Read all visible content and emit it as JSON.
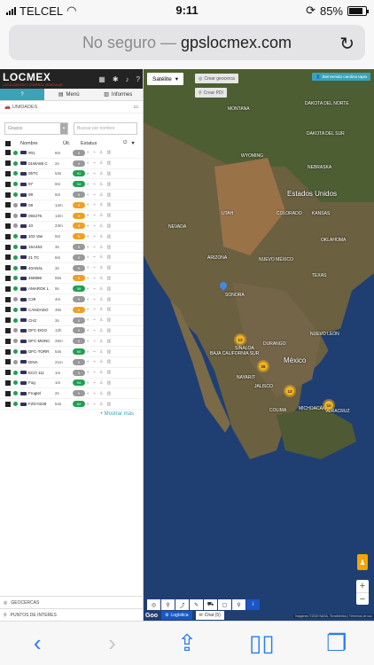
{
  "status": {
    "carrier": "TELCEL",
    "time": "9:11",
    "battery": "85%"
  },
  "browser": {
    "insecure_label": "No seguro",
    "separator": "—",
    "domain": "gpslocmex.com"
  },
  "app": {
    "logo": "LOCMEX",
    "logo_sub": "LOCALIZACIÓN Y CONTROL VEHICULAR",
    "tabs": [
      {
        "label": "?"
      },
      {
        "label": "Menú"
      },
      {
        "label": "Informes"
      }
    ],
    "unidades_label": "UNIDADES",
    "filter": {
      "select_placeholder": "Grupos",
      "search_placeholder": "Buscar por nombre"
    },
    "columns": {
      "name": "Nombre",
      "last": "Últ.",
      "status": "Estatus"
    },
    "rows": [
      {
        "name": "#01",
        "time": "6m",
        "dot": "#20a050",
        "badge": "0",
        "badge_color": "#999"
      },
      {
        "name": "01WA85 C",
        "time": "2s",
        "dot": "#20a050",
        "badge": "0",
        "badge_color": "#999"
      },
      {
        "name": "05TC",
        "time": "53s",
        "dot": "#20a050",
        "badge": "91",
        "badge_color": "#20a050"
      },
      {
        "name": "07",
        "time": "6m",
        "dot": "#20a050",
        "badge": "34",
        "badge_color": "#20a050"
      },
      {
        "name": "08",
        "time": "6m",
        "dot": "#20a050",
        "badge": "0",
        "badge_color": "#999"
      },
      {
        "name": "09",
        "time": "12m",
        "dot": "#999",
        "badge": "0",
        "badge_color": "#f0a020"
      },
      {
        "name": "094276",
        "time": "13m",
        "dot": "#999",
        "badge": "0",
        "badge_color": "#f0a020"
      },
      {
        "name": "10",
        "time": "23m",
        "dot": "#999",
        "badge": "0",
        "badge_color": "#f0a020"
      },
      {
        "name": "102 Van",
        "time": "5m",
        "dot": "#20a050",
        "badge": "0",
        "badge_color": "#f0a020"
      },
      {
        "name": "15A453",
        "time": "3s",
        "dot": "#20a050",
        "badge": "0",
        "badge_color": "#999"
      },
      {
        "name": "21 TC",
        "time": "6m",
        "dot": "#20a050",
        "badge": "0",
        "badge_color": "#999"
      },
      {
        "name": "40AN4L",
        "time": "3s",
        "dot": "#20a050",
        "badge": "0",
        "badge_color": "#999"
      },
      {
        "name": "456996",
        "time": "55s",
        "dot": "#20a050",
        "badge": "0",
        "badge_color": "#f0a020"
      },
      {
        "name": "AMAROK L",
        "time": "9s",
        "dot": "#20a050",
        "badge": "39",
        "badge_color": "#20a050"
      },
      {
        "name": "C29",
        "time": "4m",
        "dot": "#999",
        "badge": "0",
        "badge_color": "#999"
      },
      {
        "name": "CANDADO",
        "time": "48s",
        "dot": "#20a050",
        "badge": "0",
        "badge_color": "#f0a020"
      },
      {
        "name": "CH2",
        "time": "3s",
        "dot": "#20a050",
        "badge": "0",
        "badge_color": "#999"
      },
      {
        "name": "DFC-DGO",
        "time": "12h",
        "dot": "#999",
        "badge": "0",
        "badge_color": "#999"
      },
      {
        "name": "DFC-MONC",
        "time": "26m",
        "dot": "#999",
        "badge": "0",
        "badge_color": "#999"
      },
      {
        "name": "DFC-TORR",
        "time": "54s",
        "dot": "#20a050",
        "badge": "50",
        "badge_color": "#20a050"
      },
      {
        "name": "DINA",
        "time": "21m",
        "dot": "#999",
        "badge": "0",
        "badge_color": "#999"
      },
      {
        "name": "ECO 111",
        "time": "1m",
        "dot": "#20a050",
        "badge": "0",
        "badge_color": "#999"
      },
      {
        "name": "Fog",
        "time": "1m",
        "dot": "#20a050",
        "badge": "94",
        "badge_color": "#20a050"
      },
      {
        "name": "Frogtel",
        "time": "2s",
        "dot": "#20a050",
        "badge": "0",
        "badge_color": "#999"
      },
      {
        "name": "FZD-0228",
        "time": "54s",
        "dot": "#20a050",
        "badge": "64",
        "badge_color": "#20a050"
      }
    ],
    "show_more": "+ Mostrar más",
    "bottom_links": [
      "GEOCERCAS",
      "PUNTOS DE INTERES"
    ]
  },
  "map": {
    "maptype": "Satélite",
    "crear_geocerca": "Crear geocerca",
    "crear_pdi": "Crear PDI",
    "welcome": "Bienvenido carolina tapia",
    "labels": [
      {
        "text": "MONTANA",
        "cls": "small"
      },
      {
        "text": "DAKOTA DEL NORTE",
        "cls": "small"
      },
      {
        "text": "DAKOTA DEL SUR",
        "cls": "small"
      },
      {
        "text": "WYOMING",
        "cls": "small"
      },
      {
        "text": "NEBRASKA",
        "cls": "small"
      },
      {
        "text": "Estados Unidos",
        "cls": "big"
      },
      {
        "text": "COLORADO",
        "cls": "small"
      },
      {
        "text": "KANSAS",
        "cls": "small"
      },
      {
        "text": "UTAH",
        "cls": "small"
      },
      {
        "text": "NEVADA",
        "cls": "small"
      },
      {
        "text": "ARIZONA",
        "cls": "small"
      },
      {
        "text": "NUEVO MÉXICO",
        "cls": "small"
      },
      {
        "text": "OKLAHOMA",
        "cls": "small"
      },
      {
        "text": "TEXAS",
        "cls": "small"
      },
      {
        "text": "SONORA",
        "cls": "small"
      },
      {
        "text": "BAJA CALIFORNIA SUR",
        "cls": "small"
      },
      {
        "text": "SINALOA",
        "cls": "small"
      },
      {
        "text": "DURANGO",
        "cls": "small"
      },
      {
        "text": "NUEVO LEÓN",
        "cls": "small"
      },
      {
        "text": "México",
        "cls": "big"
      },
      {
        "text": "NAYARIT",
        "cls": "small"
      },
      {
        "text": "JALISCO",
        "cls": "small"
      },
      {
        "text": "COLIMA",
        "cls": "small"
      },
      {
        "text": "MICHOACÁN",
        "cls": "small"
      },
      {
        "text": "VERACRUZ",
        "cls": "small"
      }
    ],
    "clusters": [
      {
        "count": "13"
      },
      {
        "count": "26"
      },
      {
        "count": "13"
      },
      {
        "count": "10"
      }
    ],
    "logistica": "Logística",
    "chat": "Chat (5)",
    "attribution": "Imágenes ©2020 NASA, TerraMetrics | Términos de uso",
    "google": "Goo"
  }
}
